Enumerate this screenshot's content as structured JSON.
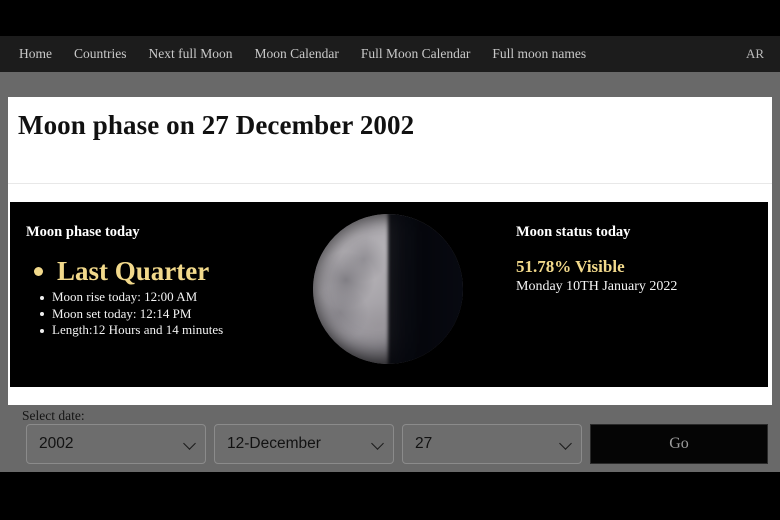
{
  "nav": {
    "items": [
      {
        "label": "Home"
      },
      {
        "label": "Countries"
      },
      {
        "label": "Next full Moon"
      },
      {
        "label": "Moon Calendar"
      },
      {
        "label": "Full Moon Calendar"
      },
      {
        "label": "Full moon names"
      }
    ],
    "language": "AR"
  },
  "card": {
    "title": "Moon phase on 27 December 2002"
  },
  "panel": {
    "left": {
      "heading": "Moon phase today",
      "phase_name": "Last Quarter",
      "facts": [
        "Moon rise today: 12:00 AM",
        "Moon set today: 12:14 PM",
        "Length:12 Hours and 14 minutes"
      ]
    },
    "moon": {
      "alt": "moon-last-quarter-image"
    },
    "right": {
      "heading": "Moon status today",
      "visible_percent": "51.78% Visible",
      "date": "Monday 10TH January 2022"
    }
  },
  "date_form": {
    "label": "Select date:",
    "year": "2002",
    "month": "12-December",
    "day": "27",
    "submit_label": "Go"
  },
  "colors": {
    "accent_gold": "#f2d98b",
    "panel_bg": "#000000",
    "page_bg": "#696969",
    "card_bg": "#ffffff",
    "nav_bg": "#1c1c1c"
  }
}
